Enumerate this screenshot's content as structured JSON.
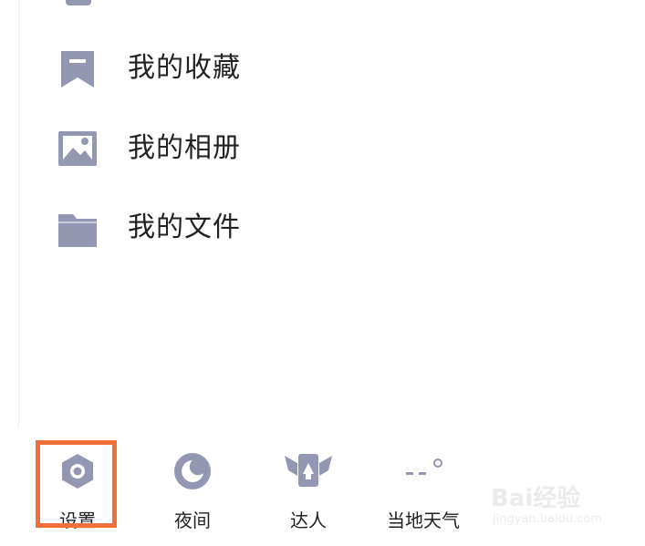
{
  "menu": {
    "items": [
      {
        "label": "我的收藏",
        "icon": "bookmark-icon"
      },
      {
        "label": "我的相册",
        "icon": "image-icon"
      },
      {
        "label": "我的文件",
        "icon": "folder-icon"
      }
    ]
  },
  "toolbar": {
    "items": [
      {
        "label": "设置",
        "icon": "settings-icon"
      },
      {
        "label": "夜间",
        "icon": "moon-icon"
      },
      {
        "label": "达人",
        "icon": "expert-icon"
      },
      {
        "label": "当地天气",
        "icon": "weather-icon"
      }
    ]
  },
  "watermark": {
    "brand": "Bai经验",
    "url": "jingyan.baidu.com"
  },
  "colors": {
    "icon": "#9497b2",
    "text": "#222222",
    "highlight": "#f0703c"
  }
}
